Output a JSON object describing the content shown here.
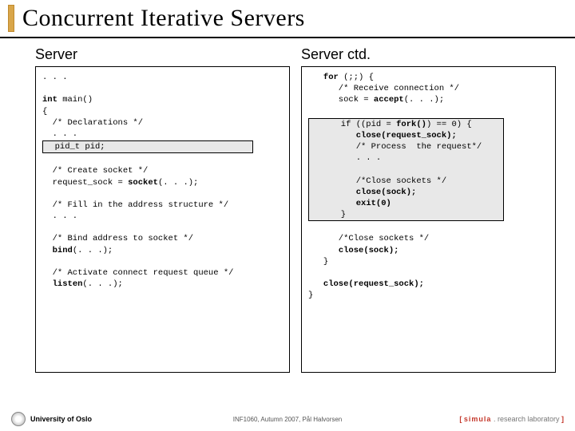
{
  "title": "Concurrent Iterative Servers",
  "left": {
    "heading": "Server",
    "l1": ". . .",
    "l2a": "int",
    "l2b": " main()",
    "l3": "{",
    "l4": "  /* Declarations */",
    "l5": "  . . .",
    "hl1": "  pid_t pid;                             ",
    "l6": "  /* Create socket */",
    "l7a": "  request_sock = ",
    "l7b": "socket",
    "l7c": "(. . .);",
    "l8": "  /* Fill in the address structure */",
    "l9": "  . . .",
    "l10": "  /* Bind address to socket */",
    "l11a": "  ",
    "l11b": "bind",
    "l11c": "(. . .);",
    "l12": "  /* Activate connect request queue */",
    "l13a": "  ",
    "l13b": "listen",
    "l13c": "(. . .);"
  },
  "right": {
    "heading": "Server ctd.",
    "r1a": "   for",
    "r1b": " (;;) {",
    "r2": "      /* Receive connection */",
    "r3a": "      sock = ",
    "r3b": "accept",
    "r3c": "(. . .);",
    "hl2_1a": "      if ((pid = ",
    "hl2_1b": "fork()",
    "hl2_1c": ") == 0) {    ",
    "hl2_2a": "         ",
    "hl2_2b": "close(request_sock);",
    "hl2_2c": "        ",
    "hl2_3": "         /* Process  the request*/   ",
    "hl2_4": "         . . .                        ",
    "hl2_5": "                                      ",
    "hl2_6": "         /*Close sockets */           ",
    "hl2_7a": "         ",
    "hl2_7b": "close(sock);",
    "hl2_7c": "                ",
    "hl2_8a": "         ",
    "hl2_8b": "exit(0)",
    "hl2_8c": "                     ",
    "hl2_9": "      }                               ",
    "r4": "      /*Close sockets */",
    "r5a": "      ",
    "r5b": "close(sock);",
    "r6": "   }",
    "r7a": "   ",
    "r7b": "close(request_sock);",
    "r8": "}"
  },
  "footer": {
    "uni": "University of Oslo",
    "course": "INF1060, Autumn 2007, Pål Halvorsen",
    "bracket_open": "[ ",
    "simula": "simula",
    "dot": " . ",
    "lab": "research laboratory",
    "bracket_close": " ]"
  }
}
